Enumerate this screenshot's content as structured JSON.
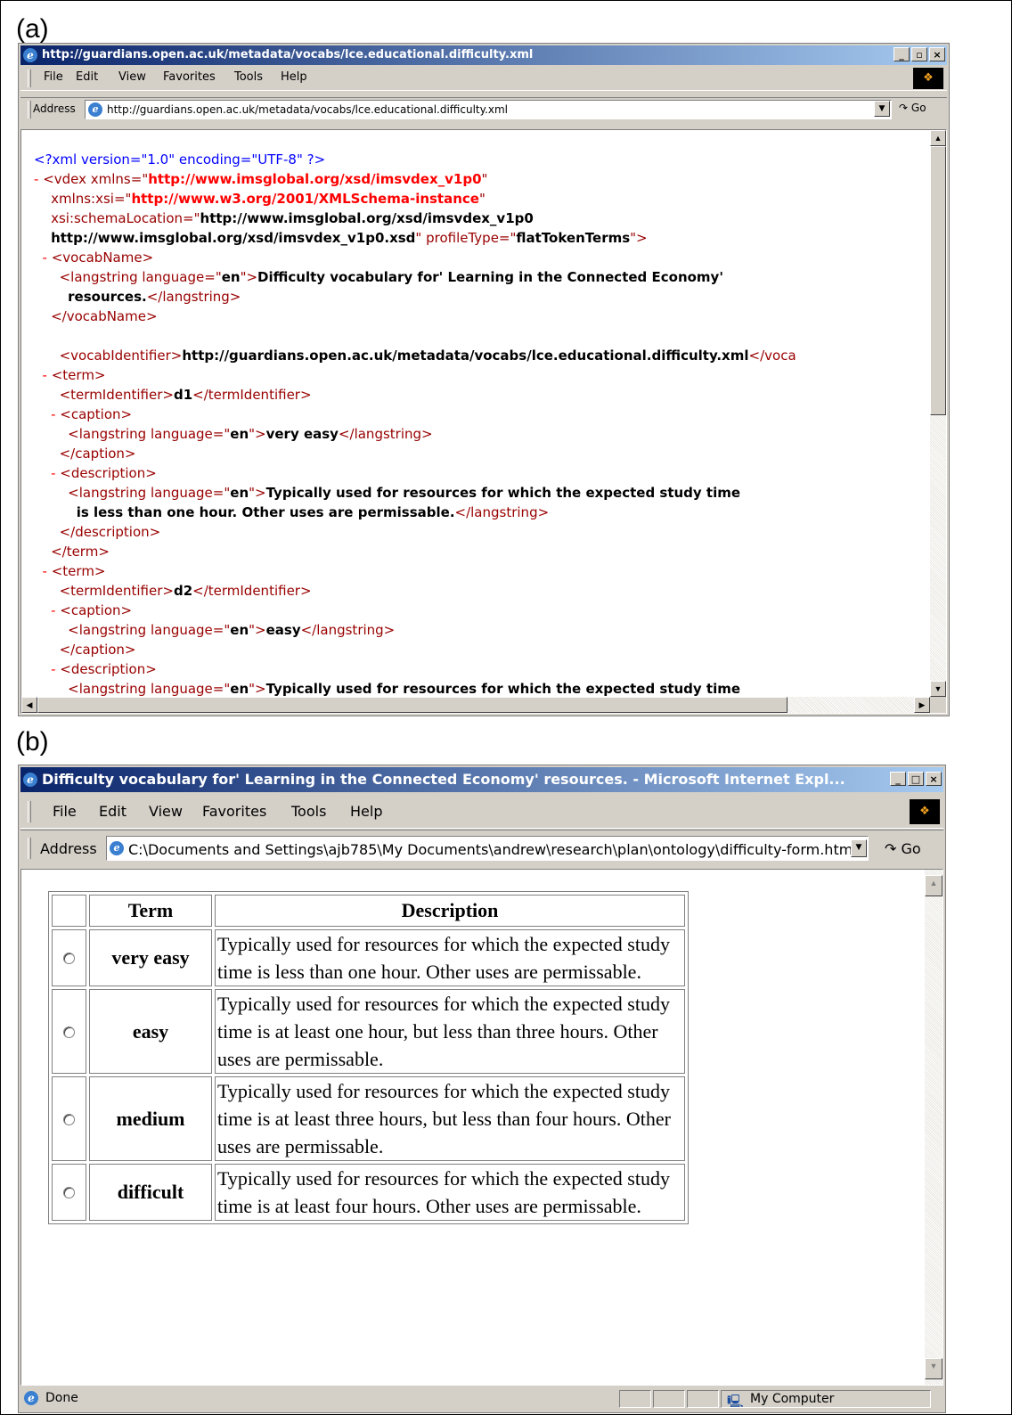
{
  "panels": {
    "a_label": "(a)",
    "b_label": "(b)"
  },
  "window_a": {
    "title": "http://guardians.open.ac.uk/metadata/vocabs/lce.educational.difficulty.xml",
    "menu": [
      "File",
      "Edit",
      "View",
      "Favorites",
      "Tools",
      "Help"
    ],
    "address_label": "Address",
    "address_value": "http://guardians.open.ac.uk/metadata/vocabs/lce.educational.difficulty.xml",
    "go_label": "Go",
    "xml_lines": [
      {
        "indent": "",
        "minus": "",
        "parts": [
          {
            "c": "pi",
            "t": "<?xml version=\"1.0\" encoding=\"UTF-8\" ?>"
          }
        ]
      },
      {
        "indent": "",
        "minus": "- ",
        "parts": [
          {
            "c": "tag",
            "t": "<vdex "
          },
          {
            "c": "attr",
            "t": "xmlns="
          },
          {
            "c": "tag",
            "t": "\""
          },
          {
            "c": "val red",
            "t": "http://www.imsglobal.org/xsd/imsvdex_v1p0"
          },
          {
            "c": "tag",
            "t": "\""
          }
        ]
      },
      {
        "indent": "    ",
        "minus": "",
        "parts": [
          {
            "c": "attr",
            "t": "xmlns:xsi="
          },
          {
            "c": "tag",
            "t": "\""
          },
          {
            "c": "val red",
            "t": "http://www.w3.org/2001/XMLSchema-instance"
          },
          {
            "c": "tag",
            "t": "\""
          }
        ]
      },
      {
        "indent": "    ",
        "minus": "",
        "parts": [
          {
            "c": "attr",
            "t": "xsi:schemaLocation="
          },
          {
            "c": "tag",
            "t": "\""
          },
          {
            "c": "val",
            "t": "http://www.imsglobal.org/xsd/imsvdex_v1p0"
          }
        ]
      },
      {
        "indent": "    ",
        "minus": "",
        "parts": [
          {
            "c": "val",
            "t": "http://www.imsglobal.org/xsd/imsvdex_v1p0.xsd"
          },
          {
            "c": "tag",
            "t": "\" "
          },
          {
            "c": "attr",
            "t": "profileType="
          },
          {
            "c": "tag",
            "t": "\""
          },
          {
            "c": "val",
            "t": "flatTokenTerms"
          },
          {
            "c": "tag",
            "t": "\">"
          }
        ]
      },
      {
        "indent": "  ",
        "minus": "- ",
        "parts": [
          {
            "c": "tag",
            "t": "<vocabName>"
          }
        ]
      },
      {
        "indent": "      ",
        "minus": "",
        "parts": [
          {
            "c": "tag",
            "t": "<langstring "
          },
          {
            "c": "attr",
            "t": "language="
          },
          {
            "c": "tag",
            "t": "\""
          },
          {
            "c": "val",
            "t": "en"
          },
          {
            "c": "tag",
            "t": "\">"
          },
          {
            "c": "txt",
            "t": "Difficulty vocabulary for' Learning in the Connected Economy'"
          }
        ]
      },
      {
        "indent": "        ",
        "minus": "",
        "parts": [
          {
            "c": "txt",
            "t": "resources."
          },
          {
            "c": "tag",
            "t": "</langstring>"
          }
        ]
      },
      {
        "indent": "    ",
        "minus": "",
        "parts": [
          {
            "c": "tag",
            "t": "</vocabName>"
          }
        ]
      },
      {
        "indent": "",
        "minus": "",
        "parts": [
          {
            "c": "txt",
            "t": ""
          }
        ]
      },
      {
        "indent": "      ",
        "minus": "",
        "parts": [
          {
            "c": "tag",
            "t": "<vocabIdentifier>"
          },
          {
            "c": "txt",
            "t": "http://guardians.open.ac.uk/metadata/vocabs/lce.educational.difficulty.xml"
          },
          {
            "c": "tag",
            "t": "</voca"
          }
        ]
      },
      {
        "indent": "  ",
        "minus": "- ",
        "parts": [
          {
            "c": "tag",
            "t": "<term>"
          }
        ]
      },
      {
        "indent": "      ",
        "minus": "",
        "parts": [
          {
            "c": "tag",
            "t": "<termIdentifier>"
          },
          {
            "c": "txt",
            "t": "d1"
          },
          {
            "c": "tag",
            "t": "</termIdentifier>"
          }
        ]
      },
      {
        "indent": "    ",
        "minus": "- ",
        "parts": [
          {
            "c": "tag",
            "t": "<caption>"
          }
        ]
      },
      {
        "indent": "        ",
        "minus": "",
        "parts": [
          {
            "c": "tag",
            "t": "<langstring "
          },
          {
            "c": "attr",
            "t": "language="
          },
          {
            "c": "tag",
            "t": "\""
          },
          {
            "c": "val",
            "t": "en"
          },
          {
            "c": "tag",
            "t": "\">"
          },
          {
            "c": "txt",
            "t": "very easy"
          },
          {
            "c": "tag",
            "t": "</langstring>"
          }
        ]
      },
      {
        "indent": "      ",
        "minus": "",
        "parts": [
          {
            "c": "tag",
            "t": "</caption>"
          }
        ]
      },
      {
        "indent": "    ",
        "minus": "- ",
        "parts": [
          {
            "c": "tag",
            "t": "<description>"
          }
        ]
      },
      {
        "indent": "        ",
        "minus": "",
        "parts": [
          {
            "c": "tag",
            "t": "<langstring "
          },
          {
            "c": "attr",
            "t": "language="
          },
          {
            "c": "tag",
            "t": "\""
          },
          {
            "c": "val",
            "t": "en"
          },
          {
            "c": "tag",
            "t": "\">"
          },
          {
            "c": "txt",
            "t": "Typically used for resources for which the expected study time"
          }
        ]
      },
      {
        "indent": "          ",
        "minus": "",
        "parts": [
          {
            "c": "txt",
            "t": "is less than one hour. Other uses are permissable."
          },
          {
            "c": "tag",
            "t": "</langstring>"
          }
        ]
      },
      {
        "indent": "      ",
        "minus": "",
        "parts": [
          {
            "c": "tag",
            "t": "</description>"
          }
        ]
      },
      {
        "indent": "    ",
        "minus": "",
        "parts": [
          {
            "c": "tag",
            "t": "</term>"
          }
        ]
      },
      {
        "indent": "  ",
        "minus": "- ",
        "parts": [
          {
            "c": "tag",
            "t": "<term>"
          }
        ]
      },
      {
        "indent": "      ",
        "minus": "",
        "parts": [
          {
            "c": "tag",
            "t": "<termIdentifier>"
          },
          {
            "c": "txt",
            "t": "d2"
          },
          {
            "c": "tag",
            "t": "</termIdentifier>"
          }
        ]
      },
      {
        "indent": "    ",
        "minus": "- ",
        "parts": [
          {
            "c": "tag",
            "t": "<caption>"
          }
        ]
      },
      {
        "indent": "        ",
        "minus": "",
        "parts": [
          {
            "c": "tag",
            "t": "<langstring "
          },
          {
            "c": "attr",
            "t": "language="
          },
          {
            "c": "tag",
            "t": "\""
          },
          {
            "c": "val",
            "t": "en"
          },
          {
            "c": "tag",
            "t": "\">"
          },
          {
            "c": "txt",
            "t": "easy"
          },
          {
            "c": "tag",
            "t": "</langstring>"
          }
        ]
      },
      {
        "indent": "      ",
        "minus": "",
        "parts": [
          {
            "c": "tag",
            "t": "</caption>"
          }
        ]
      },
      {
        "indent": "    ",
        "minus": "- ",
        "parts": [
          {
            "c": "tag",
            "t": "<description>"
          }
        ]
      },
      {
        "indent": "        ",
        "minus": "",
        "parts": [
          {
            "c": "tag",
            "t": "<langstring "
          },
          {
            "c": "attr",
            "t": "language="
          },
          {
            "c": "tag",
            "t": "\""
          },
          {
            "c": "val",
            "t": "en"
          },
          {
            "c": "tag",
            "t": "\">"
          },
          {
            "c": "txt",
            "t": "Typically used for resources for which the expected study time"
          }
        ]
      }
    ]
  },
  "window_b": {
    "title": "Difficulty vocabulary for' Learning in the Connected Economy' resources. - Microsoft Internet Expl...",
    "menu": [
      "File",
      "Edit",
      "View",
      "Favorites",
      "Tools",
      "Help"
    ],
    "address_label": "Address",
    "address_value": "C:\\Documents and Settings\\ajb785\\My Documents\\andrew\\research\\plan\\ontology\\difficulty-form.htm",
    "go_label": "Go",
    "table_headers": [
      "",
      "Term",
      "Description"
    ],
    "rows": [
      {
        "term": "very easy",
        "description": "Typically used for resources for which the expected study time is less than one hour. Other uses are permissable."
      },
      {
        "term": "easy",
        "description": "Typically used for resources for which the expected study time is at least one hour, but less than three hours. Other uses are permissable."
      },
      {
        "term": "medium",
        "description": "Typically used for resources for which the expected study time is at least three hours, but less than four hours. Other uses are permissable."
      },
      {
        "term": "difficult",
        "description": "Typically used for resources for which the expected study time is at least four hours. Other uses are permissable."
      }
    ],
    "status_text": "Done",
    "zone_text": "My Computer"
  }
}
